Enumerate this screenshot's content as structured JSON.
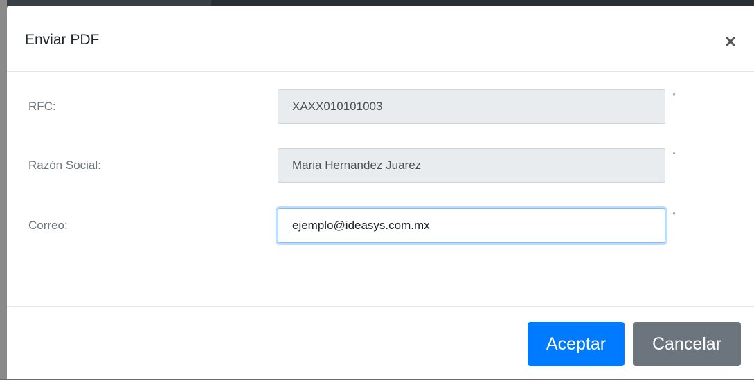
{
  "dialog": {
    "title": "Enviar PDF",
    "close_icon": "close-icon"
  },
  "form": {
    "rfc": {
      "label": "RFC:",
      "value": "XAXX010101003",
      "required_mark": "*"
    },
    "razon_social": {
      "label": "Razón Social:",
      "value": "Maria Hernandez Juarez",
      "required_mark": "*"
    },
    "correo": {
      "label": "Correo:",
      "value": "ejemplo@ideasys.com.mx",
      "required_mark": "*"
    }
  },
  "footer": {
    "accept_label": "Aceptar",
    "cancel_label": "Cancelar"
  },
  "colors": {
    "primary": "#007bff",
    "secondary": "#6c757d",
    "readonly_bg": "#e9ecef",
    "focus_border": "#80bdff"
  }
}
